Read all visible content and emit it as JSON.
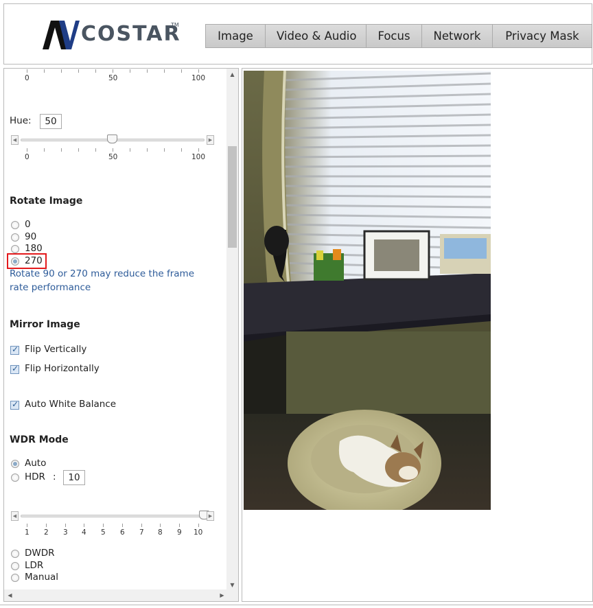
{
  "header": {
    "logo_mark": "AV",
    "logo_text": "COSTAR",
    "logo_tm": "TM",
    "tabs": [
      {
        "label": "Image"
      },
      {
        "label": "Video & Audio"
      },
      {
        "label": "Focus"
      },
      {
        "label": "Network"
      },
      {
        "label": "Privacy Mask"
      }
    ]
  },
  "settings": {
    "top_scale": {
      "min": "0",
      "mid": "50",
      "max": "100"
    },
    "hue": {
      "label": "Hue:",
      "value": "50",
      "scale": {
        "min": "0",
        "mid": "50",
        "max": "100"
      },
      "slider_fraction": 0.5
    },
    "rotate": {
      "title": "Rotate Image",
      "options": [
        {
          "label": "0",
          "selected": false
        },
        {
          "label": "90",
          "selected": false
        },
        {
          "label": "180",
          "selected": false
        },
        {
          "label": "270",
          "selected": true
        }
      ],
      "note": "Rotate 90 or 270 may reduce the frame rate performance"
    },
    "mirror": {
      "title": "Mirror Image",
      "flip_vertically": {
        "label": "Flip Vertically",
        "checked": true
      },
      "flip_horizontally": {
        "label": "Flip Horizontally",
        "checked": true
      }
    },
    "awb": {
      "label": "Auto White Balance",
      "checked": true
    },
    "wdr": {
      "title": "WDR Mode",
      "auto": {
        "label": "Auto",
        "selected": true
      },
      "hdr": {
        "label": "HDR",
        "colon": ":",
        "value": "10"
      },
      "scale": [
        "1",
        "2",
        "3",
        "4",
        "5",
        "6",
        "7",
        "8",
        "9",
        "10"
      ],
      "slider_fraction": 1.0,
      "dwdr": {
        "label": "DWDR",
        "selected": false
      },
      "ldr": {
        "label": "LDR",
        "selected": false
      },
      "manual": {
        "label": "Manual",
        "selected": false
      }
    }
  },
  "colors": {
    "note_blue": "#2d5b99",
    "highlight_red": "#e3191c",
    "logo_blue": "#1f3d86"
  },
  "icons": {
    "scroll_up": "▲",
    "scroll_down": "▼",
    "scroll_left": "◀",
    "scroll_right": "▶",
    "check": "✓"
  }
}
